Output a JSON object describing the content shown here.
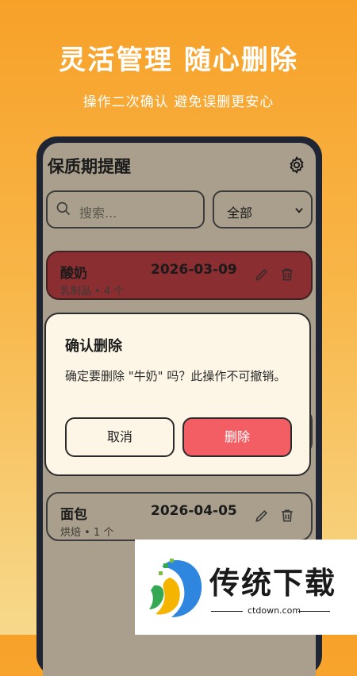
{
  "promo": {
    "title": "灵活管理 随心删除",
    "subtitle": "操作二次确认 避免误删更安心"
  },
  "app": {
    "title": "保质期提醒",
    "settings_icon": "gear-icon",
    "search": {
      "placeholder": "搜索...",
      "icon": "search-icon"
    },
    "filter": {
      "selected": "全部",
      "icon": "chevron-down-icon"
    }
  },
  "items": [
    {
      "name": "酸奶",
      "date": "2026-03-09",
      "meta": "乳制品 • 4 个",
      "status_color": "#8a2e31"
    },
    {
      "name": "面包",
      "date": "2026-04-05",
      "meta": "烘焙 • 1 个"
    }
  ],
  "dialog": {
    "title": "确认删除",
    "message": "确定要删除 \"牛奶\" 吗？此操作不可撤销。",
    "cancel_label": "取消",
    "confirm_label": "删除",
    "confirm_color": "#f25e64"
  },
  "watermark": {
    "name": "传统下载",
    "url": "ctdown.com"
  },
  "colors": {
    "accent": "#f7a129",
    "danger": "#f25e64"
  }
}
